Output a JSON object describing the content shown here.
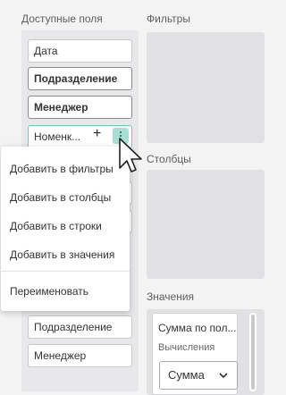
{
  "available_fields": {
    "heading": "Доступные поля",
    "items": [
      "Дата",
      "Подразделение",
      "Менеджер",
      "Номенк..."
    ],
    "lower_items": [
      "Подразделение",
      "Менеджер"
    ]
  },
  "filters": {
    "heading": "Фильтры"
  },
  "columns": {
    "heading": "Столбцы"
  },
  "values": {
    "heading": "Значения",
    "card_title": "Сумма по пол...",
    "calc_label": "Вычисления",
    "calc_select": "Сумма"
  },
  "context_menu": {
    "items": [
      "Добавить в фильтры",
      "Добавить в столбцы",
      "Добавить в строки",
      "Добавить в значения",
      "Переименовать"
    ]
  },
  "icons": {
    "add": "plus-icon",
    "more": "kebab-icon",
    "cursor": "mouse-pointer-icon",
    "dropdown": "chevron-down-icon"
  },
  "colors": {
    "accent": "#a9ded4",
    "active_border": "#7ac3b6"
  }
}
